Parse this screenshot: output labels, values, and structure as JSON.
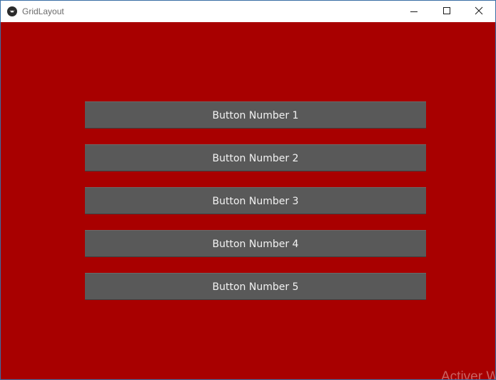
{
  "window": {
    "title": "GridLayout",
    "app_icon": "kivy-logo-icon",
    "controls": {
      "minimize_icon": "minimize-icon",
      "maximize_icon": "maximize-icon",
      "close_icon": "close-icon"
    }
  },
  "colors": {
    "background": "#a80000",
    "button": "#595959",
    "button_text": "#f2f2f2",
    "titlebar": "#ffffff"
  },
  "buttons": [
    {
      "label": "Button Number 1"
    },
    {
      "label": "Button Number 2"
    },
    {
      "label": "Button Number 3"
    },
    {
      "label": "Button Number 4"
    },
    {
      "label": "Button Number 5"
    }
  ],
  "watermark": {
    "text": "Activer W"
  }
}
